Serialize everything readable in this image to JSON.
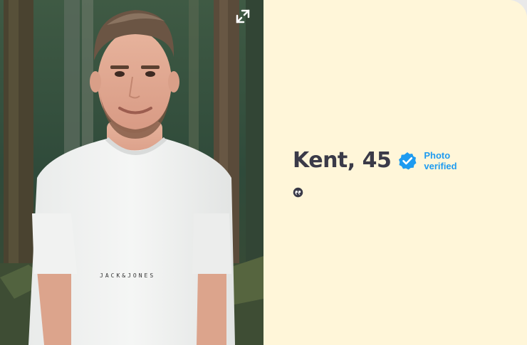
{
  "profile": {
    "name_age": "Kent, 45",
    "verified_label_line1": "Photo",
    "verified_label_line2": "verified",
    "tshirt_print": "JACK&JONES"
  },
  "icons": {
    "expand": "expand-icon",
    "verified": "verified-check-icon",
    "quote": "quote-icon"
  },
  "colors": {
    "panel_background": "#fff6d9",
    "name_text": "#3a3a48",
    "verified_blue": "#1e9bf0"
  }
}
